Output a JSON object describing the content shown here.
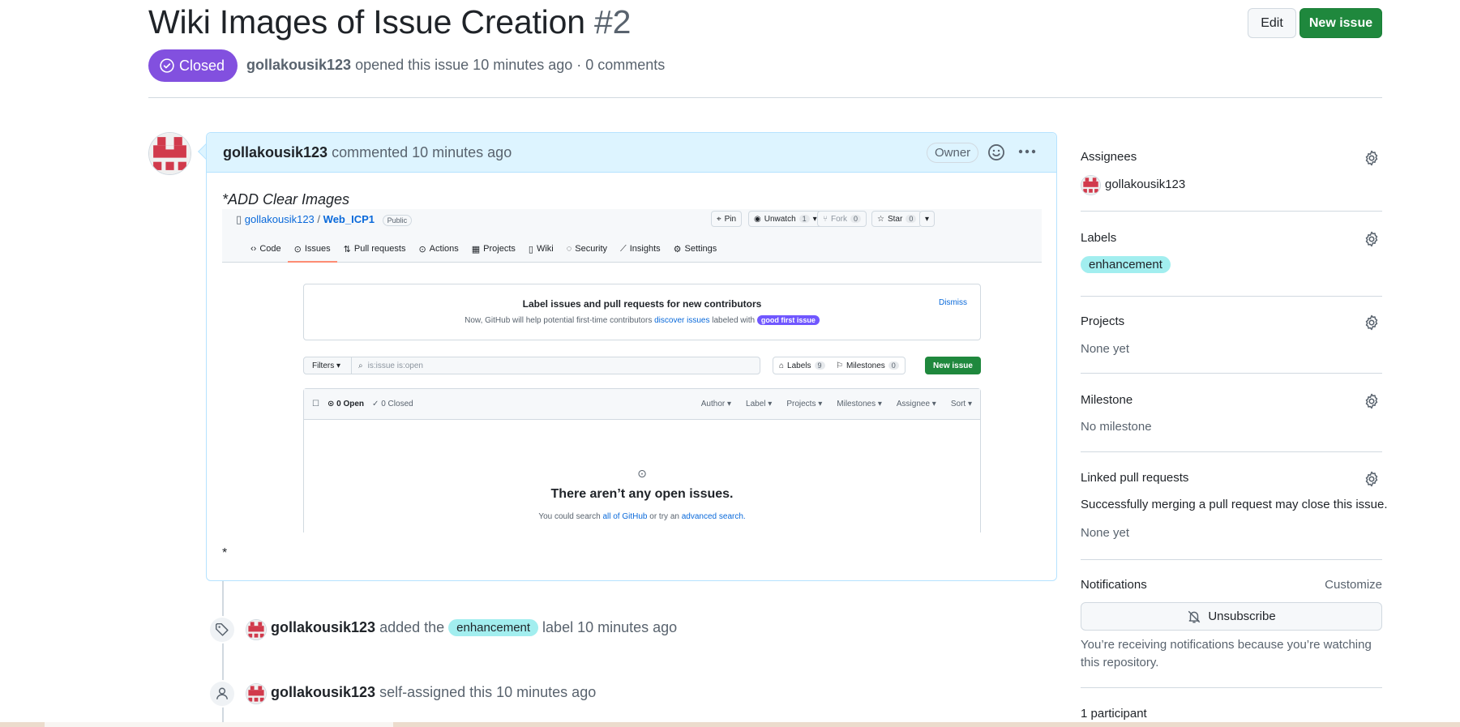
{
  "issue": {
    "title": "Wiki Images of Issue Creation",
    "number": "#2",
    "state": "Closed",
    "author": "gollakousik123",
    "meta_text": "opened this issue 10 minutes ago · 0 comments"
  },
  "header_buttons": {
    "edit": "Edit",
    "new_issue": "New issue"
  },
  "comment": {
    "author": "gollakousik123",
    "action": "commented 10 minutes ago",
    "badge": "Owner",
    "body_title": "*ADD Clear Images",
    "body_trailer": "*"
  },
  "screenshot": {
    "repo_owner": "gollakousik123",
    "repo_sep": "/",
    "repo_name": "Web_ICP1",
    "visibility": "Public",
    "pin": "Pin",
    "unwatch": "Unwatch",
    "unwatch_count": "1",
    "fork": "Fork",
    "fork_count": "0",
    "star": "Star",
    "star_count": "0",
    "tabs": [
      "Code",
      "Issues",
      "Pull requests",
      "Actions",
      "Projects",
      "Wiki",
      "Security",
      "Insights",
      "Settings"
    ],
    "banner_title": "Label issues and pull requests for new contributors",
    "banner_text_1": "Now, GitHub will help potential first-time contributors",
    "banner_link": "discover issues",
    "banner_text_2": "labeled with",
    "banner_label": "good first issue",
    "dismiss": "Dismiss",
    "filters": "Filters",
    "search_value": "is:issue is:open",
    "labels_btn": "Labels",
    "labels_count": "9",
    "milestones_btn": "Milestones",
    "milestones_count": "0",
    "new_issue": "New issue",
    "open_count": "0 Open",
    "closed_count": "0 Closed",
    "sort_filters": [
      "Author",
      "Label",
      "Projects",
      "Milestones",
      "Assignee",
      "Sort"
    ],
    "empty_title": "There aren’t any open issues.",
    "empty_text_1": "You could search",
    "empty_link_1": "all of GitHub",
    "empty_text_2": "or try an",
    "empty_link_2": "advanced search."
  },
  "timeline": [
    {
      "author": "gollakousik123",
      "pre": "added the",
      "label": "enhancement",
      "post": "label 10 minutes ago"
    },
    {
      "author": "gollakousik123",
      "pre": "self-assigned this 10 minutes ago"
    }
  ],
  "sidebar": {
    "assignees_title": "Assignees",
    "assignee": "gollakousik123",
    "labels_title": "Labels",
    "label": "enhancement",
    "projects_title": "Projects",
    "projects_value": "None yet",
    "milestone_title": "Milestone",
    "milestone_value": "No milestone",
    "linked_title": "Linked pull requests",
    "linked_desc": "Successfully merging a pull request may close this issue.",
    "linked_value": "None yet",
    "notifications_title": "Notifications",
    "customize": "Customize",
    "unsubscribe": "Unsubscribe",
    "notif_reason": "You’re receiving notifications because you’re watching this repository.",
    "participants": "1 participant"
  },
  "colors": {
    "closed": "#8250df",
    "primary": "#1f883d",
    "enhancement": "#a2eeef",
    "comment_header": "#ddf4ff"
  }
}
